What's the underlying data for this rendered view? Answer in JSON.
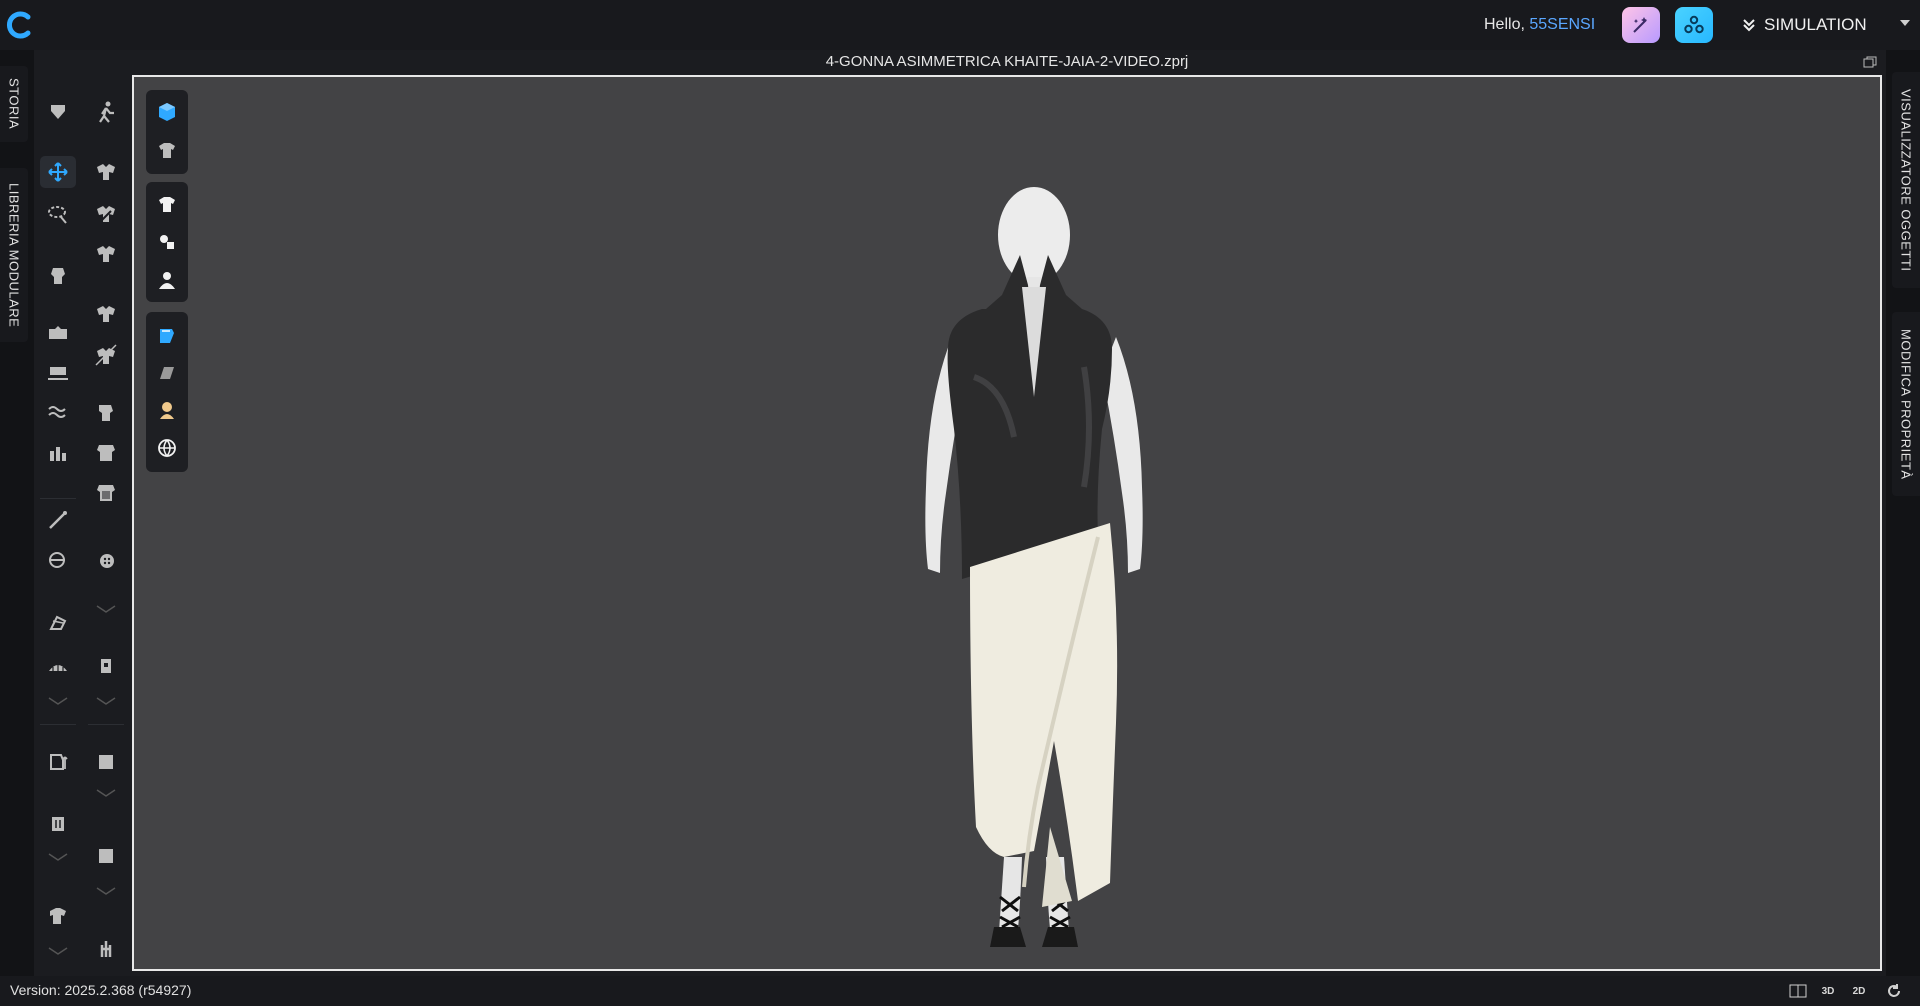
{
  "header": {
    "greeting": "Hello, ",
    "username": "55SENSI",
    "mode_label": "SIMULATION",
    "ai_buttons": [
      "ai-assist-icon",
      "connect-icon"
    ]
  },
  "left_tabs": [
    "STORIA",
    "LIBRERIA MODULARE"
  ],
  "right_tabs": [
    "VISUALIZZATORE OGGETTI",
    "MODIFICA PROPRIETÀ"
  ],
  "viewport": {
    "file_title": "4-GONNA ASIMMETRICA KHAITE-JAIA-2-VIDEO.zprj"
  },
  "view_toolbar": {
    "groups": [
      [
        "cube-view-icon",
        "garment-solid-icon"
      ],
      [
        "shirt-icon",
        "pieces-icon",
        "avatar-icon"
      ],
      [
        "fabric-render-icon",
        "texture-icon",
        "skin-icon",
        "globe-icon"
      ]
    ]
  },
  "status": {
    "version": "Version: 2025.2.368 (r54927)",
    "view_modes": [
      "split-view-icon",
      "3D",
      "2D",
      "refresh-icon"
    ]
  },
  "colors": {
    "accent": "#2fa9ff",
    "username": "#5aa7ff",
    "viewport_bg": "#434345",
    "top_dress": "#2b2b2c",
    "skirt": "#efece0",
    "avatar": "#e9e9e9"
  }
}
